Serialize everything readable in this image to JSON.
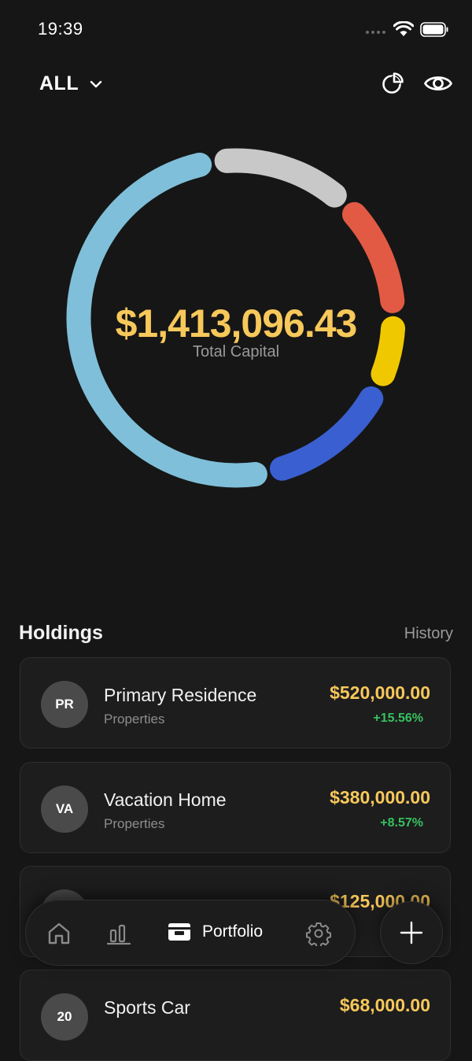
{
  "status_bar": {
    "time": "19:39"
  },
  "header": {
    "filter_label": "ALL"
  },
  "summary": {
    "total_value": "$1,413,096.43",
    "total_label": "Total Capital"
  },
  "allocation": {
    "segments": [
      {
        "category": "Properties",
        "share": 0.51,
        "color": "#7FBFD9"
      },
      {
        "category": "Gray",
        "share": 0.145,
        "color": "#C8C8C8"
      },
      {
        "category": "Red",
        "share": 0.125,
        "color": "#E25A44"
      },
      {
        "category": "Yellow",
        "share": 0.075,
        "color": "#F0C800"
      },
      {
        "category": "Blue",
        "share": 0.145,
        "color": "#3A5FD0"
      }
    ]
  },
  "holdings": {
    "title": "Holdings",
    "history_label": "History",
    "items": [
      {
        "initials": "PR",
        "name": "Primary Residence",
        "category": "Properties",
        "value": "$520,000.00",
        "change": "+15.56%"
      },
      {
        "initials": "VA",
        "name": "Vacation Home",
        "category": "Properties",
        "value": "$380,000.00",
        "change": "+8.57%"
      },
      {
        "initials": "",
        "name": "",
        "category": "",
        "value": "$125,000.00",
        "change": ""
      },
      {
        "initials": "20",
        "name": "Sports Car",
        "category": "",
        "value": "$68,000.00",
        "change": ""
      }
    ]
  },
  "nav": {
    "portfolio_label": "Portfolio"
  }
}
